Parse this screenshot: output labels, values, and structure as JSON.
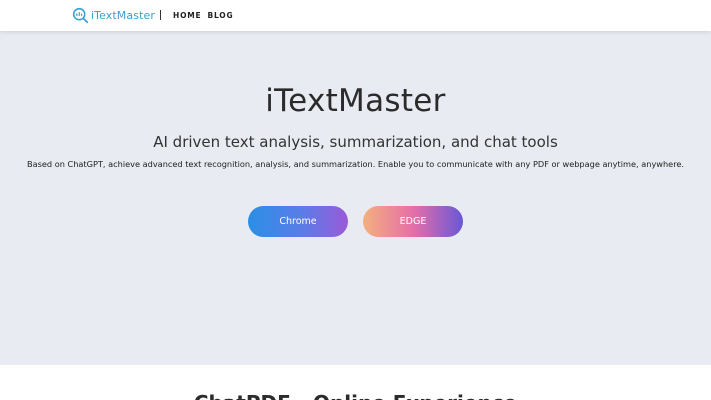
{
  "header": {
    "logo_text": "iTextMaster",
    "nav": [
      {
        "label": "HOME"
      },
      {
        "label": "BLOG"
      }
    ]
  },
  "hero": {
    "title": "iTextMaster",
    "subtitle": "AI driven text analysis, summarization, and chat tools",
    "description": "Based on ChatGPT, achieve advanced text recognition, analysis, and summarization. Enable you to communicate with any PDF or webpage anytime, anywhere.",
    "buttons": {
      "chrome": "Chrome",
      "edge": "EDGE"
    }
  },
  "section": {
    "title": "ChatPDF - Online Experience"
  },
  "colors": {
    "logo": "#3a9fd1",
    "hero_bg": "#e8ebf1",
    "chrome_gradient": [
      "#2a8fe6",
      "#9a5ad8"
    ],
    "edge_gradient": [
      "#f3b07e",
      "#6a57d6"
    ]
  },
  "icons": {
    "logo": "magnifier-chat-icon"
  }
}
